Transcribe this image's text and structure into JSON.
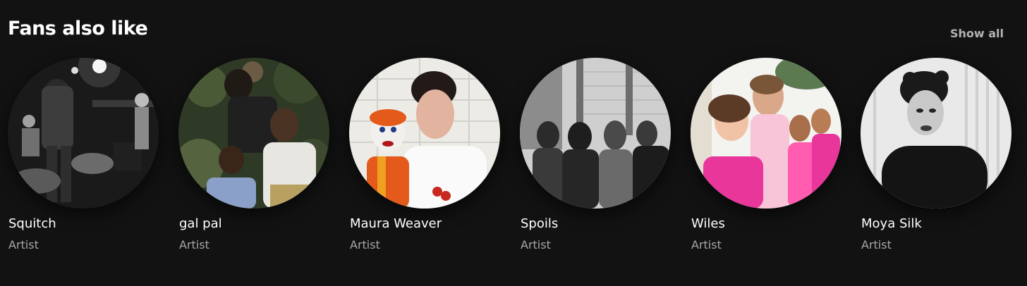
{
  "section": {
    "title": "Fans also like",
    "show_all_label": "Show all"
  },
  "artists": [
    {
      "name": "Squitch",
      "subtitle": "Artist",
      "image": "band-live-photo"
    },
    {
      "name": "gal pal",
      "subtitle": "Artist",
      "image": "band-group-photo"
    },
    {
      "name": "Maura Weaver",
      "subtitle": "Artist",
      "image": "artist-portrait-with-clown-doll"
    },
    {
      "name": "Spoils",
      "subtitle": "Artist",
      "image": "band-group-photo"
    },
    {
      "name": "Wiles",
      "subtitle": "Artist",
      "image": "band-group-photo"
    },
    {
      "name": "Moya Silk",
      "subtitle": "Artist",
      "image": "artist-portrait"
    }
  ],
  "colors": {
    "background": "#121212",
    "primary_text": "#ffffff",
    "secondary_text": "#a7a7a7",
    "show_all_text": "#b3b3b3"
  }
}
